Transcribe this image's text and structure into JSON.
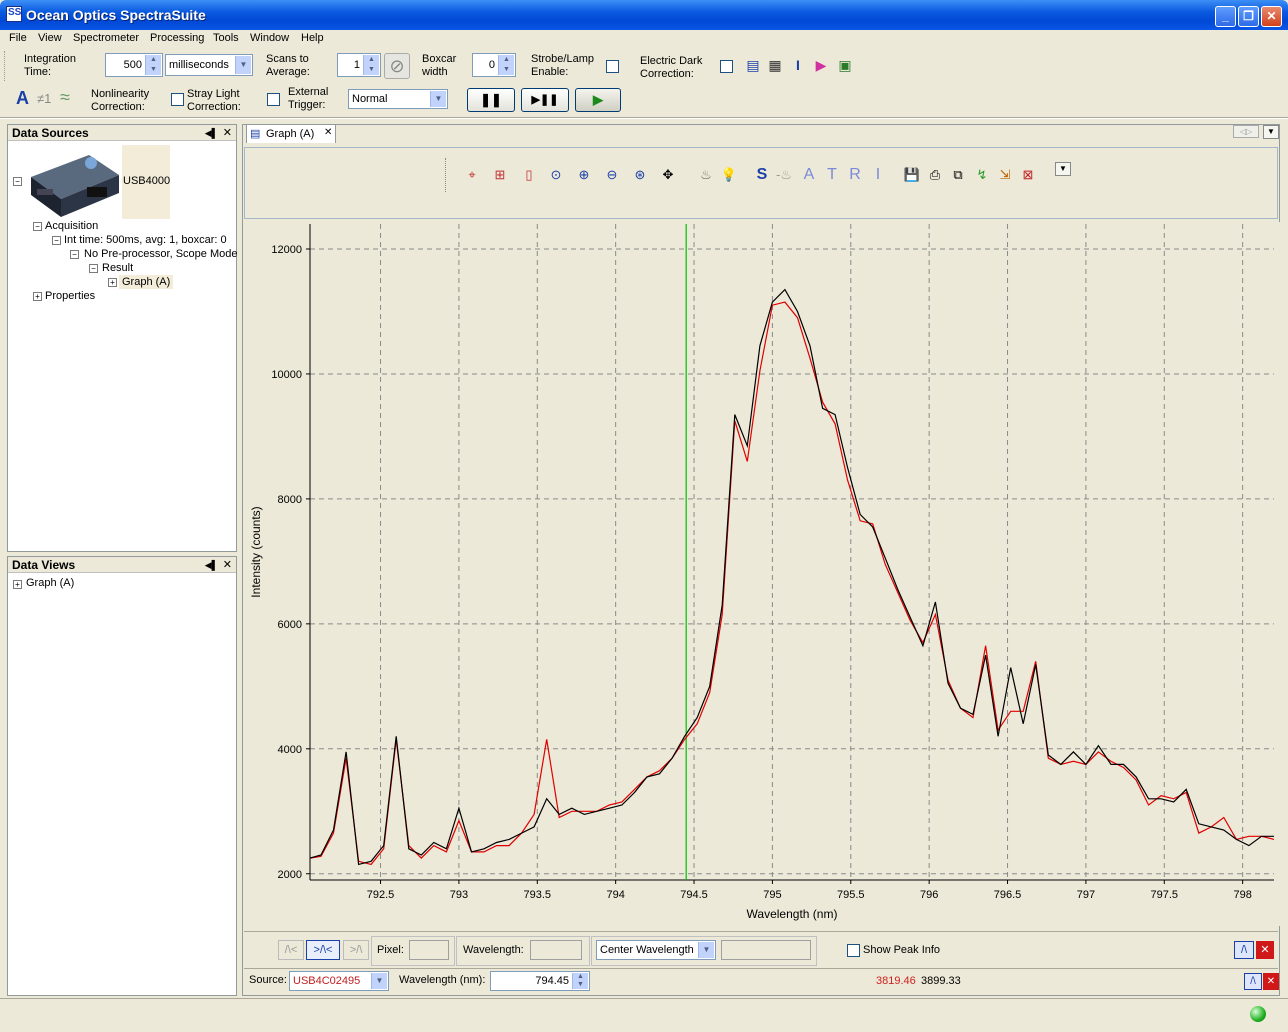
{
  "window": {
    "title": "Ocean Optics SpectraSuite",
    "app_icon_text": "SS"
  },
  "menu": [
    "File",
    "View",
    "Spectrometer",
    "Processing",
    "Tools",
    "Window",
    "Help"
  ],
  "toolbar": {
    "integration_label_1": "Integration",
    "integration_label_2": "Time:",
    "integration_value": "500",
    "integration_unit": "milliseconds",
    "scans_label_1": "Scans to",
    "scans_label_2": "Average:",
    "scans_value": "1",
    "boxcar_label_1": "Boxcar",
    "boxcar_label_2": "width",
    "boxcar_value": "0",
    "strobe_label_1": "Strobe/Lamp",
    "strobe_label_2": "Enable:",
    "dark_label_1": "Electric Dark",
    "dark_label_2": "Correction:",
    "nonlin_label_1": "Nonlinearity",
    "nonlin_label_2": "Correction:",
    "stray_label_1": "Stray Light",
    "stray_label_2": "Correction:",
    "trigger_label_1": "External",
    "trigger_label_2": "Trigger:",
    "trigger_value": "Normal",
    "pause_glyph": "❚❚",
    "step_glyph": "▶❚❚",
    "play_glyph": "▶"
  },
  "data_sources": {
    "title": "Data Sources",
    "device": "USB4000",
    "acquisition": "Acquisition",
    "int_time": "Int time: 500ms, avg: 1, boxcar: 0",
    "preproc": "No Pre-processor, Scope Mode",
    "result": "Result",
    "graph": "Graph (A)",
    "properties": "Properties"
  },
  "data_views": {
    "title": "Data Views",
    "graph": "Graph (A)"
  },
  "graph_tab": {
    "label": "Graph (A)"
  },
  "graph_toolbar": {
    "letters": [
      "S",
      "A",
      "T",
      "R",
      "I"
    ]
  },
  "bottom": {
    "pixel_label": "Pixel:",
    "wavelength_label": "Wavelength:",
    "center_select": "Center Wavelength",
    "show_peak": "Show Peak Info",
    "source_label": "Source:",
    "source_value": "USB4C02495",
    "wl_nm_label": "Wavelength (nm):",
    "wl_nm_value": "794.45",
    "readout_red": "3819.46",
    "readout_black": "3899.33"
  },
  "colors": {
    "series1": "#e00000",
    "series2": "#000000",
    "cursor": "#00c000",
    "title_blue": "#0a5ae0"
  },
  "chart_data": {
    "type": "line",
    "xlabel": "Wavelength (nm)",
    "ylabel": "Intensity (counts)",
    "xlim": [
      792.05,
      798.2
    ],
    "ylim": [
      1900,
      12400
    ],
    "x_ticks": [
      792.5,
      793,
      793.5,
      794,
      794.5,
      795,
      795.5,
      796,
      796.5,
      797,
      797.5,
      798
    ],
    "x_tick_labels": [
      "792.5",
      "793",
      "793.5",
      "794",
      "794.5",
      "795",
      "795.5",
      "796",
      "796.5",
      "797",
      "797.5",
      "798"
    ],
    "y_ticks": [
      2000,
      4000,
      6000,
      8000,
      10000,
      12000
    ],
    "y_tick_labels": [
      "2000",
      "4000",
      "6000",
      "8000",
      "10000",
      "12000"
    ],
    "grid": true,
    "cursor_x": 794.45,
    "series": [
      {
        "color": "#e00000",
        "x": [
          792.05,
          792.12,
          792.2,
          792.28,
          792.36,
          792.44,
          792.52,
          792.6,
          792.68,
          792.76,
          792.84,
          792.92,
          793.0,
          793.08,
          793.16,
          793.24,
          793.32,
          793.4,
          793.48,
          793.56,
          793.64,
          793.72,
          793.8,
          793.88,
          793.96,
          794.04,
          794.12,
          794.2,
          794.28,
          794.36,
          794.44,
          794.52,
          794.6,
          794.68,
          794.76,
          794.84,
          794.92,
          795.0,
          795.08,
          795.16,
          795.24,
          795.32,
          795.4,
          795.48,
          795.56,
          795.64,
          795.72,
          795.8,
          795.88,
          795.96,
          796.04,
          796.12,
          796.2,
          796.28,
          796.36,
          796.44,
          796.52,
          796.6,
          796.68,
          796.76,
          796.84,
          796.92,
          797.0,
          797.08,
          797.16,
          797.24,
          797.32,
          797.4,
          797.48,
          797.56,
          797.64,
          797.72,
          797.8,
          797.88,
          797.96,
          798.04,
          798.12,
          798.2
        ],
        "y": [
          2250,
          2280,
          2650,
          3850,
          2200,
          2150,
          2400,
          4150,
          2450,
          2250,
          2450,
          2350,
          2850,
          2350,
          2350,
          2450,
          2450,
          2650,
          2950,
          4150,
          2900,
          3000,
          3000,
          3000,
          3100,
          3150,
          3350,
          3550,
          3650,
          3850,
          4150,
          4400,
          4900,
          6150,
          9250,
          8600,
          10050,
          11100,
          11150,
          10900,
          10250,
          9550,
          9200,
          8300,
          7650,
          7600,
          6950,
          6500,
          6050,
          5700,
          6150,
          5100,
          4650,
          4500,
          5650,
          4300,
          4600,
          4600,
          5400,
          3850,
          3750,
          3800,
          3750,
          3950,
          3800,
          3700,
          3500,
          3100,
          3250,
          3200,
          3300,
          2650,
          2750,
          2900,
          2550,
          2600,
          2600,
          2550
        ]
      },
      {
        "color": "#000000",
        "x": [
          792.05,
          792.12,
          792.2,
          792.28,
          792.36,
          792.44,
          792.52,
          792.6,
          792.68,
          792.76,
          792.84,
          792.92,
          793.0,
          793.08,
          793.16,
          793.24,
          793.32,
          793.4,
          793.48,
          793.56,
          793.64,
          793.72,
          793.8,
          793.88,
          793.96,
          794.04,
          794.12,
          794.2,
          794.28,
          794.36,
          794.44,
          794.52,
          794.6,
          794.68,
          794.76,
          794.84,
          794.92,
          795.0,
          795.08,
          795.16,
          795.24,
          795.32,
          795.4,
          795.48,
          795.56,
          795.64,
          795.72,
          795.8,
          795.88,
          795.96,
          796.04,
          796.12,
          796.2,
          796.28,
          796.36,
          796.44,
          796.52,
          796.6,
          796.68,
          796.76,
          796.84,
          796.92,
          797.0,
          797.08,
          797.16,
          797.24,
          797.32,
          797.4,
          797.48,
          797.56,
          797.64,
          797.72,
          797.8,
          797.88,
          797.96,
          798.04,
          798.12,
          798.2
        ],
        "y": [
          2250,
          2300,
          2700,
          3950,
          2150,
          2200,
          2450,
          4200,
          2400,
          2300,
          2500,
          2400,
          3050,
          2350,
          2400,
          2500,
          2550,
          2650,
          2750,
          3200,
          2950,
          3050,
          2950,
          3000,
          3050,
          3100,
          3300,
          3550,
          3600,
          3850,
          4200,
          4500,
          5000,
          6300,
          9350,
          8850,
          10450,
          11150,
          11350,
          11000,
          10450,
          9450,
          9350,
          8500,
          7750,
          7550,
          7050,
          6550,
          6100,
          5650,
          6350,
          5050,
          4650,
          4550,
          5500,
          4200,
          5300,
          4400,
          5350,
          3900,
          3750,
          3950,
          3750,
          4050,
          3750,
          3750,
          3550,
          3200,
          3200,
          3150,
          3350,
          2800,
          2750,
          2700,
          2550,
          2450,
          2600,
          2600
        ]
      }
    ]
  }
}
